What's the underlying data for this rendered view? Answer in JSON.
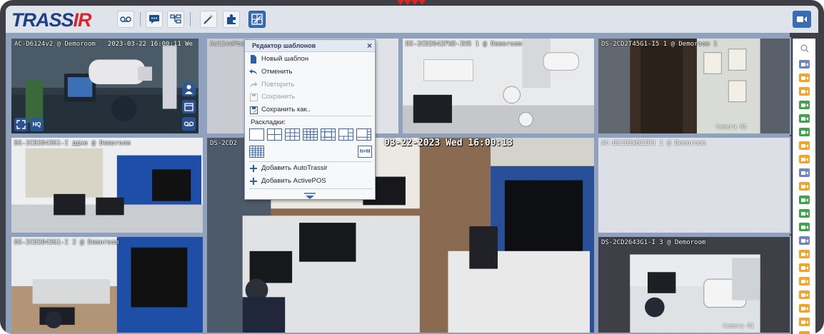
{
  "app": {
    "logo_main": "TRASS",
    "logo_accent": "IR"
  },
  "toolbar": {
    "buttons": [
      {
        "name": "archive-playback-button",
        "icon": "tape-icon"
      },
      {
        "name": "chat-button",
        "icon": "chat-icon"
      },
      {
        "name": "tree-button",
        "icon": "tree-icon"
      },
      {
        "name": "wizard-button",
        "icon": "magic-wand-icon"
      },
      {
        "name": "plugins-button",
        "icon": "puzzle-icon"
      },
      {
        "name": "template-editor-button",
        "icon": "layout-edit-icon",
        "active": true
      }
    ],
    "right_button": {
      "name": "camera-button",
      "icon": "video-camera-icon"
    }
  },
  "template_editor": {
    "title": "Редактор шаблонов",
    "close_label": "×",
    "items": [
      {
        "label": "Новый шаблон",
        "icon": "new-document-icon",
        "enabled": true
      },
      {
        "label": "Отменить",
        "icon": "undo-icon",
        "enabled": true
      },
      {
        "label": "Повторить",
        "icon": "redo-icon",
        "enabled": false
      },
      {
        "label": "Сохранить",
        "icon": "save-icon",
        "enabled": false
      },
      {
        "label": "Сохранить как..",
        "icon": "save-as-icon",
        "enabled": true
      }
    ],
    "layouts_label": "Раскладки:",
    "nm_label": "N×M",
    "add_items": [
      {
        "label": "Добавить AutoTrassir",
        "icon": "plus-icon"
      },
      {
        "label": "Добавить ActivePOS",
        "icon": "plus-icon"
      }
    ]
  },
  "tiles": [
    {
      "label": "AC-D6124v2 @ Demoroom",
      "time": "2023-03-22 16:00:11 We"
    },
    {
      "label": "ActivePos"
    },
    {
      "label": "DS-2CD2642FWD-IWS 1 @ Demoroom"
    },
    {
      "label": "DS-2CD2T45G1-I5 1 @ Demoroom 1",
      "corner": "Camera 01"
    },
    {
      "label": "DS-2CD2643G1-I ддмо @ Demoroom"
    },
    {
      "label": "DS-2CD2",
      "osd": "03-22-2023 Wed 16:00:13"
    },
    {
      "label": "AC-D2183WDZIR3 1 @ Demoroom"
    },
    {
      "label": "DS-2CD2643G1-I 2 @ Demoroom"
    },
    {
      "label": "DS-2CD2643G1-I 3 @ Demoroom",
      "corner": "Camera 01"
    }
  ],
  "colors": {
    "accent": "#3b6db3",
    "logo_blue": "#1d3f88",
    "logo_red": "#d8262e",
    "cam_blue": "#6f86b9",
    "cam_orange": "#f0a42a",
    "cam_green": "#3fa34d"
  },
  "sidebar_cameras": [
    "blue",
    "orange",
    "orange",
    "green",
    "green",
    "green",
    "orange",
    "orange",
    "blue",
    "orange",
    "green",
    "green",
    "green",
    "blue",
    "orange",
    "orange",
    "orange",
    "orange",
    "orange",
    "orange",
    "orange"
  ]
}
